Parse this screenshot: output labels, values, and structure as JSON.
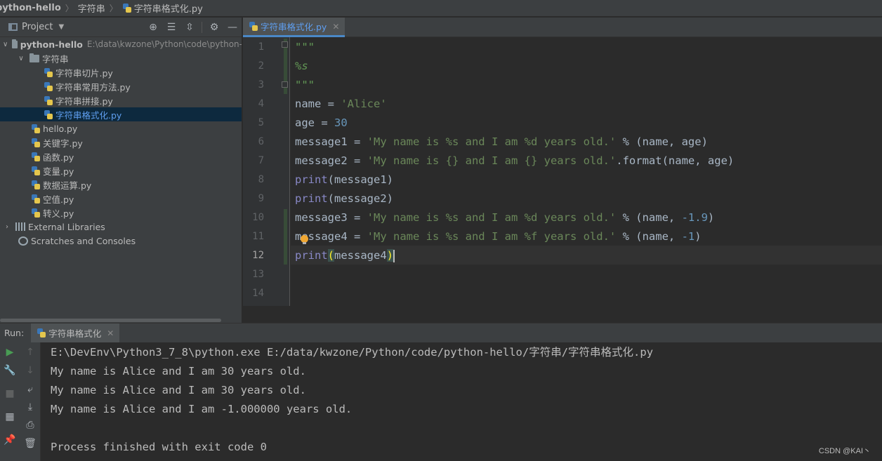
{
  "breadcrumb": {
    "project": "python-hello",
    "folder": "字符串",
    "file": "字符串格式化.py"
  },
  "project_panel": {
    "title": "Project",
    "toolbar_icons": [
      "crosshair-icon",
      "expand-all-icon",
      "collapse-all-icon",
      "gear-icon",
      "minimize-icon"
    ],
    "root": {
      "label": "python-hello",
      "path": "E:\\data\\kwzone\\Python\\code\\python-"
    },
    "folder": {
      "label": "字符串"
    },
    "folder_files": [
      "字符串切片.py",
      "字符串常用方法.py",
      "字符串拼接.py",
      "字符串格式化.py"
    ],
    "selected_file": "字符串格式化.py",
    "root_files": [
      "hello.py",
      "关键字.py",
      "函数.py",
      "变量.py",
      "数据运算.py",
      "空值.py",
      "转义.py"
    ],
    "external_libraries": "External Libraries",
    "scratches": "Scratches and Consoles"
  },
  "editor": {
    "tab_label": "字符串格式化.py",
    "current_line": 12,
    "line_numbers": [
      "1",
      "2",
      "3",
      "4",
      "5",
      "6",
      "7",
      "8",
      "9",
      "10",
      "11",
      "12",
      "13",
      "14"
    ],
    "code": {
      "l1": "\"\"\"",
      "l2": "%s",
      "l3": "\"\"\"",
      "l4_var": "name = ",
      "l4_str": "'Alice'",
      "l5_var": "age = ",
      "l5_num": "30",
      "l6_var": "message1 = ",
      "l6_str": "'My name is %s and I am %d years old.'",
      "l6_rest": " % (name, age)",
      "l7_var": "message2 = ",
      "l7_str": "'My name is {} and I am {} years old.'",
      "l7_rest": ".format(name, age)",
      "l8_fn": "print",
      "l8_rest": "(message1)",
      "l9_fn": "print",
      "l9_rest": "(message2)",
      "l10_var": "message3 = ",
      "l10_str": "'My name is %s and I am %d years old.'",
      "l10_mid": " % (name, ",
      "l10_num": "-1.9",
      "l10_end": ")",
      "l11_var": "message4 = ",
      "l11_str": "'My name is %s and I am %f years old.'",
      "l11_mid": " % (name, ",
      "l11_num": "-1",
      "l11_end": ")",
      "l12_fn": "print",
      "l12_open": "(",
      "l12_arg": "message4",
      "l12_close": ")"
    }
  },
  "run": {
    "label": "Run:",
    "tab_label": "字符串格式化",
    "tools": [
      "rerun-icon",
      "up-arrow-icon",
      "wrench-icon",
      "down-arrow-icon",
      "stop-icon",
      "soft-wrap-icon",
      "scroll-to-end-icon",
      "layout-icon",
      "print-icon",
      "pin-icon",
      "trash-icon"
    ],
    "console": [
      "E:\\DevEnv\\Python3_7_8\\python.exe E:/data/kwzone/Python/code/python-hello/字符串/字符串格式化.py",
      "My name is Alice and I am 30 years old.",
      "My name is Alice and I am 30 years old.",
      "My name is Alice and I am -1.000000 years old.",
      "",
      "Process finished with exit code 0"
    ]
  },
  "watermark": "CSDN @KAI丶"
}
